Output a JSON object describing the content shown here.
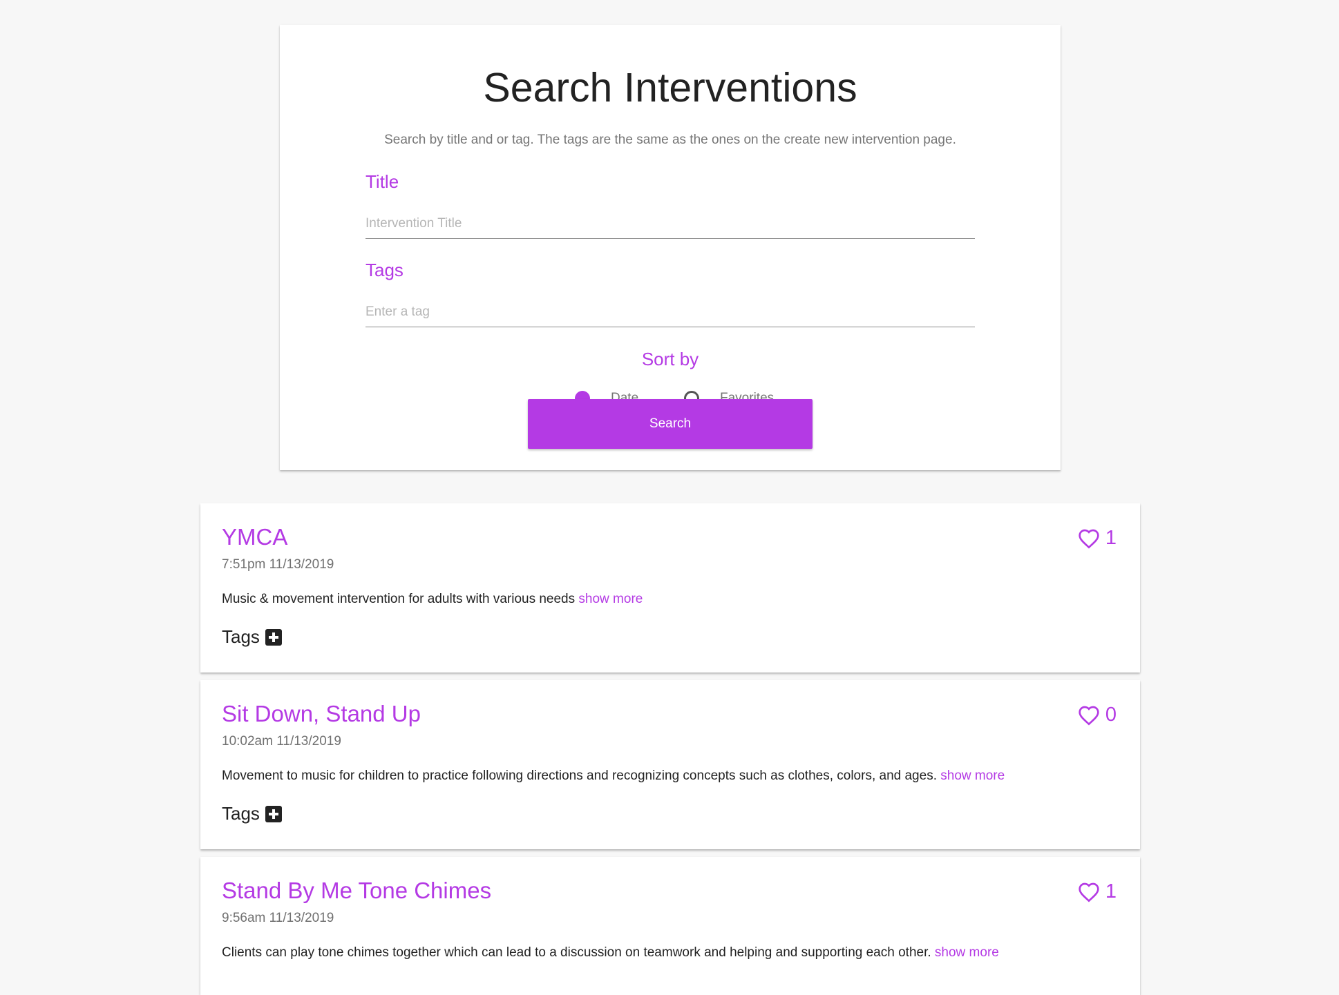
{
  "search": {
    "title": "Search Interventions",
    "description": "Search by title and or tag. The tags are the same as the ones on the create new intervention page.",
    "title_field": {
      "label": "Title",
      "placeholder": "Intervention Title",
      "value": ""
    },
    "tags_field": {
      "label": "Tags",
      "placeholder": "Enter a tag",
      "value": ""
    },
    "sort_label": "Sort by",
    "sort_options": [
      {
        "label": "Date",
        "selected": true
      },
      {
        "label": "Favorites",
        "selected": false
      }
    ],
    "button_label": "Search"
  },
  "colors": {
    "accent": "#b43ae4",
    "background": "#f7f7f7"
  },
  "results": [
    {
      "title": "YMCA",
      "date": "7:51pm 11/13/2019",
      "description": "Music & movement intervention for adults with various needs",
      "show_more": "show more",
      "favorites": "1",
      "tags_label": "Tags",
      "favorite_icon": "heart-outline-icon",
      "tag_add_icon": "plus-box-icon"
    },
    {
      "title": "Sit Down, Stand Up",
      "date": "10:02am 11/13/2019",
      "description": "Movement to music for children to practice following directions and recognizing concepts such as clothes, colors, and ages.",
      "show_more": "show more",
      "favorites": "0",
      "tags_label": "Tags",
      "favorite_icon": "heart-outline-icon",
      "tag_add_icon": "plus-box-icon"
    },
    {
      "title": "Stand By Me Tone Chimes",
      "date": "9:56am 11/13/2019",
      "description": "Clients can play tone chimes together which can lead to a discussion on teamwork and helping and supporting each other.",
      "show_more": "show more",
      "favorites": "1",
      "favorite_icon": "heart-outline-icon"
    }
  ]
}
